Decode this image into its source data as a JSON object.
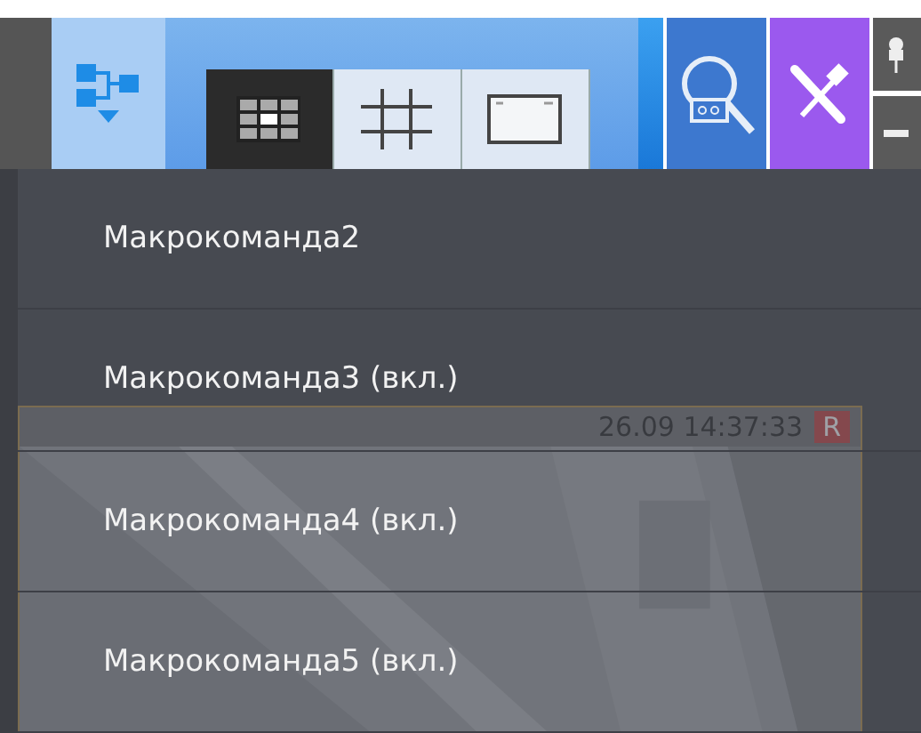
{
  "toolbar": {
    "view_tabs": [
      {
        "kind": "grid",
        "selected": true
      },
      {
        "kind": "crosshair",
        "selected": false
      },
      {
        "kind": "window",
        "selected": false
      }
    ]
  },
  "camera": {
    "timestamp": "26.09 14:37:33",
    "badge": "R"
  },
  "menu": {
    "items": [
      {
        "label": "Макрокоманда2"
      },
      {
        "label": "Макрокоманда3 (вкл.)"
      },
      {
        "label": "Макрокоманда4 (вкл.)"
      },
      {
        "label": "Макрокоманда5 (вкл.)"
      }
    ]
  }
}
